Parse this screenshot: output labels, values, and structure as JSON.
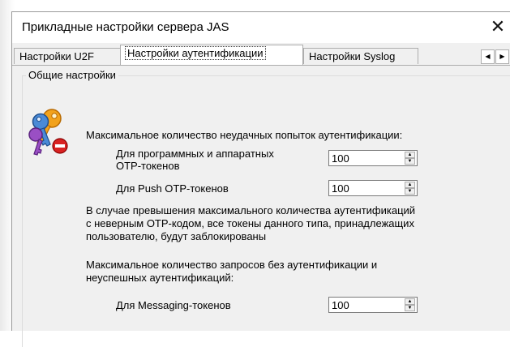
{
  "window": {
    "title": "Прикладные настройки сервера JAS",
    "close_glyph": "✕"
  },
  "tabs": [
    {
      "label": "Настройки U2F",
      "active": false
    },
    {
      "label": "Настройки аутентификации",
      "active": true
    },
    {
      "label": "Настройки Syslog",
      "active": false
    }
  ],
  "tab_scroll": {
    "left_glyph": "◀",
    "right_glyph": "▶"
  },
  "group": {
    "title": "Общие настройки"
  },
  "icons": {
    "auth_icon": "keys-with-block-icon"
  },
  "failed_attempts": {
    "heading": "Максимальное количество неудачных попыток аутентификации:",
    "software_hardware_label_line1": "Для программных и аппаратных",
    "software_hardware_label_line2": "OTP-токенов",
    "software_hardware_value": "100",
    "push_label": "Для Push OTP-токенов",
    "push_value": "100"
  },
  "warning": {
    "line1": "В случае превышения максимального количества аутентификаций",
    "line2": "с неверным OTP-кодом, все токены данного типа, принадлежащих",
    "line3": "пользователю, будут заблокированы"
  },
  "requests": {
    "heading_line1": "Максимальное количество запросов без аутентификации и",
    "heading_line2": "неуспешных аутентификаций:",
    "messaging_label": "Для Messaging-токенов",
    "messaging_value": "100"
  },
  "spin_glyphs": {
    "up": "▲",
    "down": "▼"
  }
}
